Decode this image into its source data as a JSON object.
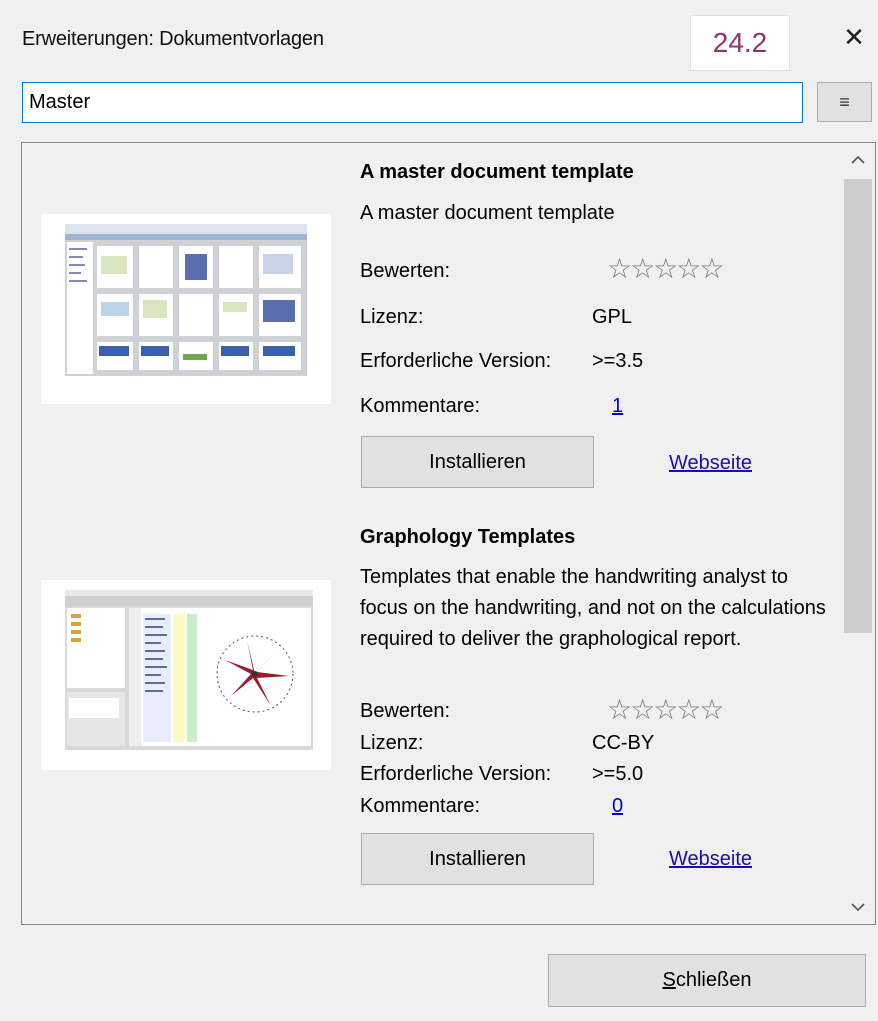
{
  "window": {
    "title": "Erweiterungen: Dokumentvorlagen",
    "version_badge": "24.2",
    "close_glyph": "✕"
  },
  "search": {
    "value": "Master"
  },
  "menu_button": {
    "icon": "hamburger-icon",
    "glyph": "≡"
  },
  "extensions": [
    {
      "title": "A master document template",
      "description": "A master document template",
      "rating_label": "Bewerten:",
      "rating_stars": "☆☆☆☆☆",
      "rating_value": 0,
      "license_label": "Lizenz:",
      "license": "GPL",
      "version_label": "Erforderliche Version:",
      "version": ">=3.5",
      "comments_label": "Kommentare:",
      "comments": "1",
      "install_label": "Installieren",
      "website_label": "Webseite"
    },
    {
      "title": "Graphology Templates",
      "description": "Templates that enable the handwriting analyst to focus on the handwriting, and not on the calculations required to deliver the graphological report.",
      "rating_label": "Bewerten:",
      "rating_stars": "☆☆☆☆☆",
      "rating_value": 0,
      "license_label": "Lizenz:",
      "license": "CC-BY",
      "version_label": "Erforderliche Version:",
      "version": ">=5.0",
      "comments_label": "Kommentare:",
      "comments": "0",
      "install_label": "Installieren",
      "website_label": "Webseite"
    }
  ],
  "footer": {
    "close_label_first": "S",
    "close_label_rest": "chließen"
  },
  "colors": {
    "accent": "#0078d7",
    "badge_text": "#8e3370",
    "link": "#1a0dab"
  }
}
